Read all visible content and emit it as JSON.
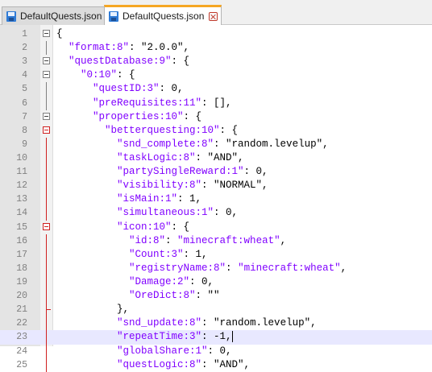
{
  "tabs": [
    {
      "label": "DefaultQuests.json",
      "active": false
    },
    {
      "label": "DefaultQuests.json",
      "active": true
    }
  ],
  "colors": {
    "key": "#8000ff",
    "purple_value": "#8000ff",
    "fold_active": "#d02020",
    "tab_accent": "#f5a623",
    "current_line": "#e8e8ff"
  },
  "icons": {
    "file_icon": "floppy-disk-icon",
    "close_icon": "close-icon"
  },
  "lines": [
    {
      "n": "1",
      "fold": "box",
      "tokens": [
        {
          "t": "{",
          "c": "op"
        }
      ]
    },
    {
      "n": "2",
      "fold": "line",
      "tokens": [
        {
          "t": "  ",
          "c": "op"
        },
        {
          "t": "\"format:8\"",
          "c": "k"
        },
        {
          "t": ": \"2.0.0\",",
          "c": "op"
        }
      ]
    },
    {
      "n": "3",
      "fold": "box",
      "tokens": [
        {
          "t": "  ",
          "c": "op"
        },
        {
          "t": "\"questDatabase:9\"",
          "c": "k"
        },
        {
          "t": ": {",
          "c": "op"
        }
      ]
    },
    {
      "n": "4",
      "fold": "box",
      "tokens": [
        {
          "t": "    ",
          "c": "op"
        },
        {
          "t": "\"0:10\"",
          "c": "k"
        },
        {
          "t": ": {",
          "c": "op"
        }
      ]
    },
    {
      "n": "5",
      "fold": "line",
      "tokens": [
        {
          "t": "      ",
          "c": "op"
        },
        {
          "t": "\"questID:3\"",
          "c": "k"
        },
        {
          "t": ": 0,",
          "c": "op"
        }
      ]
    },
    {
      "n": "6",
      "fold": "line",
      "tokens": [
        {
          "t": "      ",
          "c": "op"
        },
        {
          "t": "\"preRequisites:11\"",
          "c": "k"
        },
        {
          "t": ": [],",
          "c": "op"
        }
      ]
    },
    {
      "n": "7",
      "fold": "box",
      "tokens": [
        {
          "t": "      ",
          "c": "op"
        },
        {
          "t": "\"properties:10\"",
          "c": "k"
        },
        {
          "t": ": {",
          "c": "op"
        }
      ]
    },
    {
      "n": "8",
      "fold": "box-red",
      "tokens": [
        {
          "t": "        ",
          "c": "op"
        },
        {
          "t": "\"betterquesting:10\"",
          "c": "k"
        },
        {
          "t": ": {",
          "c": "op"
        }
      ]
    },
    {
      "n": "9",
      "fold": "line-red",
      "tokens": [
        {
          "t": "          ",
          "c": "op"
        },
        {
          "t": "\"snd_complete:8\"",
          "c": "k"
        },
        {
          "t": ": \"random.levelup\",",
          "c": "op"
        }
      ]
    },
    {
      "n": "10",
      "fold": "line-red",
      "tokens": [
        {
          "t": "          ",
          "c": "op"
        },
        {
          "t": "\"taskLogic:8\"",
          "c": "k"
        },
        {
          "t": ": \"AND\",",
          "c": "op"
        }
      ]
    },
    {
      "n": "11",
      "fold": "line-red",
      "tokens": [
        {
          "t": "          ",
          "c": "op"
        },
        {
          "t": "\"partySingleReward:1\"",
          "c": "k"
        },
        {
          "t": ": 0,",
          "c": "op"
        }
      ]
    },
    {
      "n": "12",
      "fold": "line-red",
      "tokens": [
        {
          "t": "          ",
          "c": "op"
        },
        {
          "t": "\"visibility:8\"",
          "c": "k"
        },
        {
          "t": ": \"NORMAL\",",
          "c": "op"
        }
      ]
    },
    {
      "n": "13",
      "fold": "line-red",
      "tokens": [
        {
          "t": "          ",
          "c": "op"
        },
        {
          "t": "\"isMain:1\"",
          "c": "k"
        },
        {
          "t": ": 1,",
          "c": "op"
        }
      ]
    },
    {
      "n": "14",
      "fold": "line-red",
      "tokens": [
        {
          "t": "          ",
          "c": "op"
        },
        {
          "t": "\"simultaneous:1\"",
          "c": "k"
        },
        {
          "t": ": 0,",
          "c": "op"
        }
      ]
    },
    {
      "n": "15",
      "fold": "box-red",
      "tokens": [
        {
          "t": "          ",
          "c": "op"
        },
        {
          "t": "\"icon:10\"",
          "c": "k"
        },
        {
          "t": ": {",
          "c": "op"
        }
      ]
    },
    {
      "n": "16",
      "fold": "line-red",
      "tokens": [
        {
          "t": "            ",
          "c": "op"
        },
        {
          "t": "\"id:8\"",
          "c": "k"
        },
        {
          "t": ": ",
          "c": "op"
        },
        {
          "t": "\"minecraft:wheat\"",
          "c": "p"
        },
        {
          "t": ",",
          "c": "op"
        }
      ]
    },
    {
      "n": "17",
      "fold": "line-red",
      "tokens": [
        {
          "t": "            ",
          "c": "op"
        },
        {
          "t": "\"Count:3\"",
          "c": "k"
        },
        {
          "t": ": 1,",
          "c": "op"
        }
      ]
    },
    {
      "n": "18",
      "fold": "line-red",
      "tokens": [
        {
          "t": "            ",
          "c": "op"
        },
        {
          "t": "\"registryName:8\"",
          "c": "k"
        },
        {
          "t": ": ",
          "c": "op"
        },
        {
          "t": "\"minecraft:wheat\"",
          "c": "p"
        },
        {
          "t": ",",
          "c": "op"
        }
      ]
    },
    {
      "n": "19",
      "fold": "line-red",
      "tokens": [
        {
          "t": "            ",
          "c": "op"
        },
        {
          "t": "\"Damage:2\"",
          "c": "k"
        },
        {
          "t": ": 0,",
          "c": "op"
        }
      ]
    },
    {
      "n": "20",
      "fold": "line-red",
      "tokens": [
        {
          "t": "            ",
          "c": "op"
        },
        {
          "t": "\"OreDict:8\"",
          "c": "k"
        },
        {
          "t": ": \"\"",
          "c": "op"
        }
      ]
    },
    {
      "n": "21",
      "fold": "end-red",
      "tokens": [
        {
          "t": "          },",
          "c": "op"
        }
      ]
    },
    {
      "n": "22",
      "fold": "line-red",
      "tokens": [
        {
          "t": "          ",
          "c": "op"
        },
        {
          "t": "\"snd_update:8\"",
          "c": "k"
        },
        {
          "t": ": \"random.levelup\",",
          "c": "op"
        }
      ]
    },
    {
      "n": "23",
      "fold": "line-red",
      "current": true,
      "tokens": [
        {
          "t": "          ",
          "c": "op"
        },
        {
          "t": "\"repeatTime:3\"",
          "c": "k"
        },
        {
          "t": ": -1,",
          "c": "op"
        }
      ]
    },
    {
      "n": "24",
      "fold": "line-red",
      "tokens": [
        {
          "t": "          ",
          "c": "op"
        },
        {
          "t": "\"globalShare:1\"",
          "c": "k"
        },
        {
          "t": ": 0,",
          "c": "op"
        }
      ]
    },
    {
      "n": "25",
      "fold": "line-red",
      "tokens": [
        {
          "t": "          ",
          "c": "op"
        },
        {
          "t": "\"questLogic:8\"",
          "c": "k"
        },
        {
          "t": ": \"AND\",",
          "c": "op"
        }
      ]
    }
  ]
}
